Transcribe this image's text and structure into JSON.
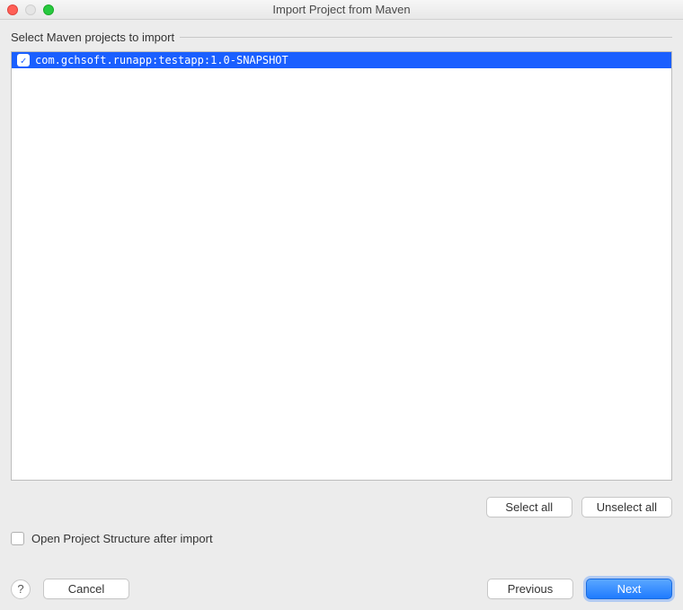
{
  "window": {
    "title": "Import Project from Maven"
  },
  "section": {
    "title": "Select Maven projects to import"
  },
  "projects": [
    {
      "label": "com.gchsoft.runapp:testapp:1.0-SNAPSHOT",
      "checked": true,
      "selected": true
    }
  ],
  "buttons": {
    "select_all": "Select all",
    "unselect_all": "Unselect all",
    "help": "?",
    "cancel": "Cancel",
    "previous": "Previous",
    "next": "Next"
  },
  "options": {
    "open_structure": "Open Project Structure after import"
  }
}
